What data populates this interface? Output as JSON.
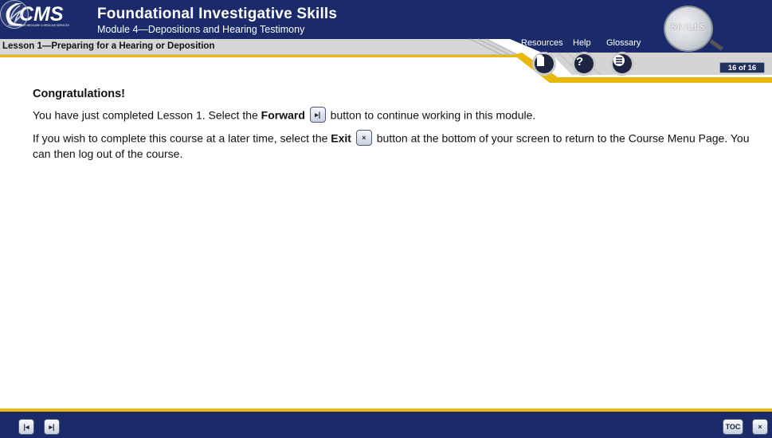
{
  "header": {
    "logo_text": "CMS",
    "logo_subtext": "CENTERS FOR MEDICARE & MEDICAID SERVICES",
    "course_title": "Foundational Investigative Skills",
    "module_title": "Module 4—Depositions and Hearing Testimony",
    "lesson_title": "Lesson 1—Preparing for a Hearing or Deposition",
    "skills_badge": "SKILLS",
    "page_counter": "16 of 16"
  },
  "nav": {
    "resources_label": "Resources",
    "help_label": "Help",
    "glossary_label": "Glossary"
  },
  "content": {
    "heading": "Congratulations!",
    "p1_before": "You have just completed Lesson 1. Select the ",
    "p1_bold": "Forward",
    "p1_after": " button to continue working in this module.",
    "p2_before": "If you wish to complete this course at a later time, select the ",
    "p2_bold": "Exit",
    "p2_after": " button at the bottom of your screen to return to the Course Menu Page. You can then log out of the course.",
    "forward_glyph": "▸|",
    "exit_glyph": "×"
  },
  "footer": {
    "back_glyph": "|◂",
    "forward_glyph": "▸|",
    "toc_label": "TOC",
    "exit_glyph": "×"
  },
  "colors": {
    "header_navy": "#1a2a6a",
    "gold": "#e8b80c",
    "silver": "#d9d9d9"
  },
  "icons": {
    "resources": "document-icon",
    "help": "question-mark-icon",
    "glossary": "list-icon",
    "back": "step-backward-icon",
    "forward": "step-forward-icon",
    "exit": "close-icon"
  }
}
